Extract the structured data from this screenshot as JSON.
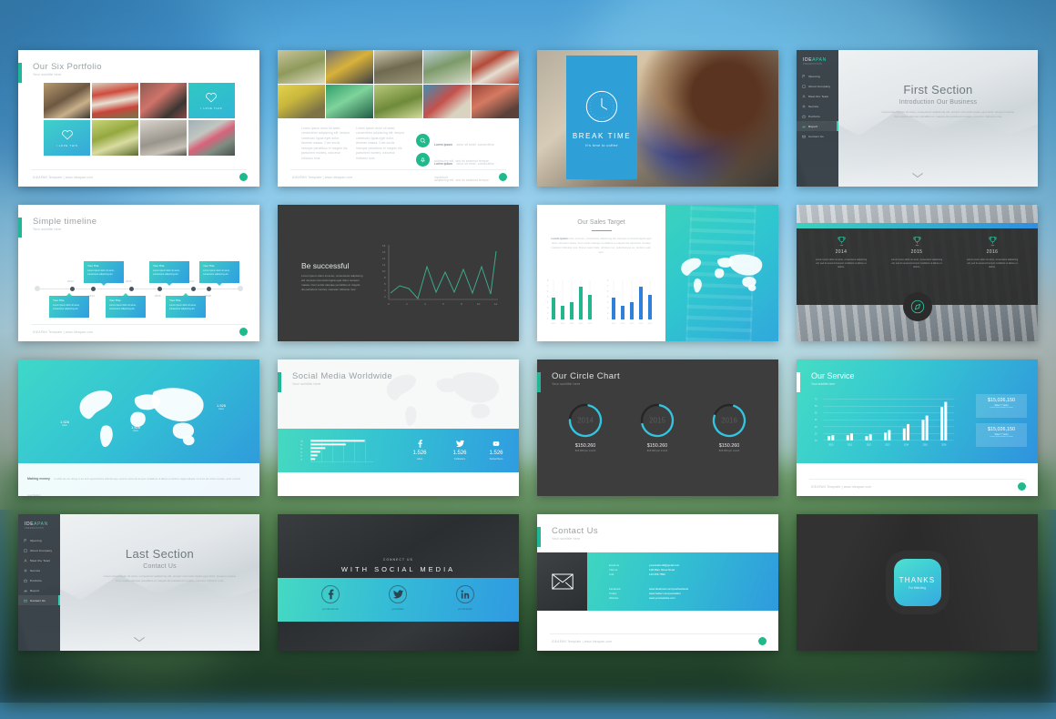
{
  "common": {
    "subtitle": "Your subtitle here",
    "footer": "IDEAPAN Template | www.ideapan.com",
    "lorem_short": "Lorem ipsum dolor sit amet, consectetur adipiscing elit, sed do eiusmod tempor incididunt ut labore et dolore magna aliqua.",
    "lorem_long": "Lorem ipsum dolor sit amet, consectetur adipiscing elit, tempor commodo ligula eget dolor. Aenean massa. Cum sociis natoque penatibus et magnis dis parturient montes, nascetur ridiculus mus."
  },
  "sidebar": {
    "logo_ide": "IDE",
    "logo_pan": "APAN",
    "tagline": "PRESENTATION",
    "items": [
      {
        "label": "Opening",
        "icon": "flag-icon",
        "active": false
      },
      {
        "label": "About Company",
        "icon": "building-icon",
        "active": false
      },
      {
        "label": "Meet the Team",
        "icon": "users-icon",
        "active": false
      },
      {
        "label": "Service",
        "icon": "gear-icon",
        "active": false
      },
      {
        "label": "Portfolio",
        "icon": "briefcase-icon",
        "active": false
      },
      {
        "label": "Report",
        "icon": "chart-icon",
        "active": false
      },
      {
        "label": "Contact Us",
        "icon": "mail-icon",
        "active": false
      }
    ]
  },
  "slides": {
    "portfolio": {
      "title": "Our Six Portfolio",
      "heart_label_1": "I LOVE THIS",
      "heart_label_2": "I LOVE THIS"
    },
    "mosaic": {
      "feature_1_title": "Lorem ipsum",
      "feature_1_body": "dolor sit amet, consectetur adipiscing elit, sed do eiusmod tempor incididunt.",
      "feature_2_title": "Lorem ipsum",
      "feature_2_body": "dolor sit amet, consectetur adipiscing elit, sed do eiusmod tempor.",
      "icon_1": "search-icon",
      "icon_2": "bell-icon"
    },
    "break_time": {
      "title": "BREAK TIME",
      "subtitle": "It's time to coffee",
      "icon": "clock-icon"
    },
    "first_section": {
      "title": "First Section",
      "subtitle": "Introduction Our Business"
    },
    "timeline": {
      "title": "Simple timeline",
      "years": [
        "2013",
        "2014",
        "2015",
        "2016",
        "2017",
        "2018"
      ],
      "cards": [
        {
          "heading": "Your Title",
          "body": "Lorem ipsum dolor sit amet, consectetur adipiscing elit."
        },
        {
          "heading": "Your Title",
          "body": "Lorem ipsum dolor sit amet, consectetur adipiscing elit."
        },
        {
          "heading": "Your Title",
          "body": "Lorem ipsum dolor sit amet, consectetur adipiscing elit."
        },
        {
          "heading": "Your Title",
          "body": "Lorem ipsum dolor sit amet, consectetur adipiscing elit."
        },
        {
          "heading": "Your Title",
          "body": "Lorem ipsum dolor sit amet, consectetur adipiscing elit."
        },
        {
          "heading": "Your Title",
          "body": "Lorem ipsum dolor sit amet, consectetur adipiscing elit."
        }
      ]
    },
    "be_successful": {
      "title": "Be successful",
      "body": "Lorem ipsum dolor sit amet, consectetur adipiscing elit. Aenean commodo ligula eget dolor. Aenean massa. Cum sociis natoque penatibus et magnis dis parturient montes, nascetur ridiculus mus."
    },
    "sales_target": {
      "title": "Our Sales Target",
      "body_lead": "Lorem ipsum",
      "body": "dolor sit amet, consectetur adipiscing elit. Aenean commodo ligula eget dolor. Aenean massa. Cum sociis natoque penatibus et magnis dis parturient montes, nascetur ridiculus mus. Donec quam felis, ultricies nec, pellentesque eu, pretium quis, sem."
    },
    "trophies": {
      "columns": [
        {
          "year": "2014",
          "body": "Lorem ipsum dolor sit amet, consectetur adipiscing elit, sed do eiusmod tempor incididunt ut labore et dolore.",
          "icon": "trophy-icon"
        },
        {
          "year": "2015",
          "body": "Lorem ipsum dolor sit amet, consectetur adipiscing elit, sed do eiusmod tempor incididunt ut labore et dolore.",
          "icon": "trophy-icon"
        },
        {
          "year": "2016",
          "body": "Lorem ipsum dolor sit amet, consectetur adipiscing elit, sed do eiusmod tempor incididunt ut labore et dolore.",
          "icon": "trophy-icon"
        }
      ],
      "badge_icon": "compass-icon"
    },
    "world_map": {
      "heading": "Making money",
      "body": "is what we are doing in art and opportunities with Europe, sed do eiusmod tempor incididunt ut labore et dolore magna aliqua. Ut enim ad minim veniam, quis nostrud exercitation.",
      "tags": [
        {
          "value": "1.526",
          "unit": "Likes"
        },
        {
          "value": "1.526",
          "unit": "Likes"
        },
        {
          "value": "1.526",
          "unit": "Likes"
        }
      ]
    },
    "social_media": {
      "title": "Social Media Worldwide",
      "stats": [
        {
          "icon": "facebook-icon",
          "value": "1.526",
          "label": "Likes"
        },
        {
          "icon": "twitter-icon",
          "value": "1.526",
          "label": "Followers"
        },
        {
          "icon": "youtube-icon",
          "value": "1.526",
          "label": "Subscribers"
        }
      ]
    },
    "circle_chart": {
      "title": "Our Circle Chart",
      "columns": [
        {
          "year": "2014",
          "value": "$150.260",
          "sub": "$15.000 per month"
        },
        {
          "year": "2015",
          "value": "$150.260",
          "sub": "$15.000 per month"
        },
        {
          "year": "2016",
          "value": "$150.260",
          "sub": "$15.000 per month"
        }
      ]
    },
    "our_service": {
      "title": "Our Service",
      "cards": [
        {
          "value": "$15,026,150",
          "label": "Sales 7 Years",
          "sub": "Lorem ipsum dolor sit amet"
        },
        {
          "value": "$15,026,150",
          "label": "Sales 7 Years",
          "sub": "Lorem ipsum dolor sit amet"
        }
      ]
    },
    "last_section": {
      "title": "Last Section",
      "subtitle": "Contact Us"
    },
    "connect_social": {
      "small": "CONNECT US",
      "big": "WITH SOCIAL MEDIA",
      "items": [
        {
          "icon": "facebook-icon",
          "label": "yourfacebook"
        },
        {
          "icon": "twitter-icon",
          "label": "yourtwitter"
        },
        {
          "icon": "linkedin-icon",
          "label": "yourlinkedin"
        }
      ]
    },
    "contact_us": {
      "title": "Contact Us",
      "icon": "envelope-icon",
      "rows": [
        {
          "label": "Email us",
          "value": "yourstudio.ID@gmail.com"
        },
        {
          "label": "Visit us",
          "value": "128 Main Street Road"
        },
        {
          "label": "Call",
          "value": "123 456 7890"
        }
      ],
      "rows2": [
        {
          "label": "Facebook",
          "value": "www.facebook.com/yourfacebook"
        },
        {
          "label": "Twitter",
          "value": "www.twitter.com/yourtwitter"
        },
        {
          "label": "Website",
          "value": "www.yourwebsite.com"
        }
      ]
    },
    "thanks": {
      "title": "THANKS",
      "subtitle": "For Watching"
    }
  },
  "chart_data": [
    {
      "id": "sales-target-green",
      "type": "bar",
      "title": "Our Sales Target",
      "categories": [
        "2013",
        "2014",
        "2015",
        "2016",
        "2017"
      ],
      "values": [
        5,
        3,
        4,
        8,
        6
      ],
      "ylim": [
        0,
        9
      ],
      "color": "#23b58d",
      "xlabel": "",
      "ylabel": ""
    },
    {
      "id": "sales-target-blue",
      "type": "bar",
      "title": "Our Sales Target",
      "categories": [
        "2013",
        "2014",
        "2015",
        "2016",
        "2017"
      ],
      "values": [
        5,
        3,
        4,
        8,
        6
      ],
      "ylim": [
        0,
        9
      ],
      "color": "#2f80d8",
      "xlabel": "",
      "ylabel": ""
    },
    {
      "id": "be-successful-line",
      "type": "line",
      "title": "Be successful",
      "x": [
        0,
        1,
        2,
        3,
        4,
        5,
        6,
        7,
        8,
        9,
        10,
        11
      ],
      "values": [
        2,
        5,
        4,
        1,
        11,
        3,
        9,
        3,
        10,
        3,
        11,
        2,
        16
      ],
      "ylim": [
        0,
        18
      ],
      "xlim": [
        0,
        12
      ],
      "color": "#3aa98a",
      "grid": false
    },
    {
      "id": "our-service-bars",
      "type": "bar",
      "title": "Our Service",
      "categories": [
        "2010",
        "2011",
        "2012",
        "2013",
        "2014",
        "2015",
        "2016"
      ],
      "series": [
        {
          "name": "A",
          "values": [
            4,
            5,
            4,
            7,
            11,
            20,
            33
          ]
        },
        {
          "name": "B",
          "values": [
            3,
            4,
            5,
            9,
            14,
            24,
            40
          ]
        }
      ],
      "ylim": [
        0,
        45
      ],
      "color": "#ffffff"
    },
    {
      "id": "social-media-bars",
      "type": "bar",
      "title": "Social Media Worldwide",
      "orientation": "horizontal",
      "categories": [
        "C1",
        "C2",
        "C3",
        "C4",
        "C5",
        "C6",
        "C7"
      ],
      "values": [
        92,
        62,
        28,
        19,
        14,
        10,
        7
      ],
      "ylim": [
        0,
        100
      ],
      "color": "#ffffff"
    },
    {
      "id": "circle-chart-donuts",
      "type": "pie",
      "title": "Our Circle Chart",
      "categories": [
        "2014",
        "2015",
        "2016"
      ],
      "values": [
        72,
        68,
        75
      ],
      "color": "#35c4e0"
    }
  ]
}
